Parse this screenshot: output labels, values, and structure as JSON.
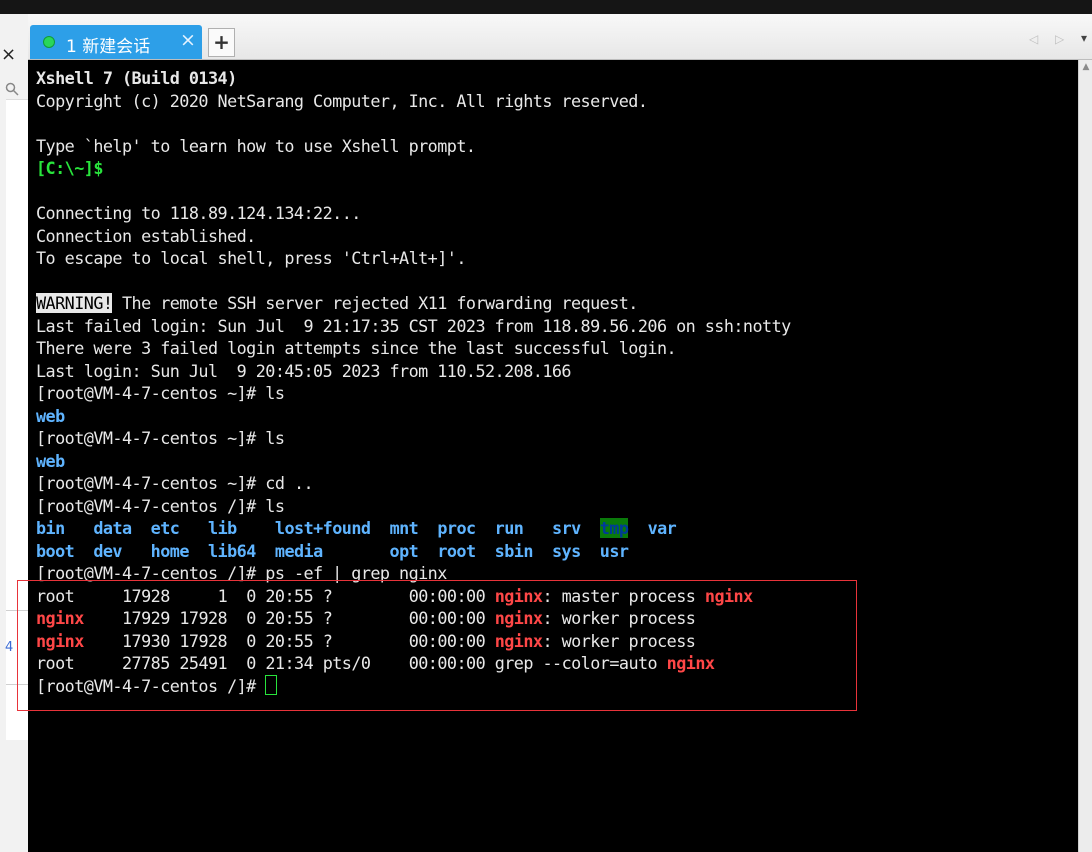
{
  "window": {
    "tab": {
      "label": "1 新建会话",
      "close": "×",
      "status_color": "#29d65c"
    },
    "add_tab": "+",
    "left_close": "×",
    "left_search_icon": "search-icon",
    "left_number": "4",
    "nav": {
      "prev": "◁",
      "next": "▷",
      "menu": "▾"
    },
    "accent": "#2d9fe8"
  },
  "terminal": {
    "header": {
      "title": "Xshell 7 (Build 0134)",
      "copyright": "Copyright (c) 2020 NetSarang Computer, Inc. All rights reserved.",
      "help": "Type `help' to learn how to use Xshell prompt.",
      "local_prompt": "[C:\\~]$"
    },
    "connect": [
      "Connecting to 118.89.124.134:22...",
      "Connection established.",
      "To escape to local shell, press 'Ctrl+Alt+]'."
    ],
    "warning": {
      "badge": "WARNING!",
      "text": " The remote SSH server rejected X11 forwarding request."
    },
    "login": [
      "Last failed login: Sun Jul  9 21:17:35 CST 2023 from 118.89.56.206 on ssh:notty",
      "There were 3 failed login attempts since the last successful login.",
      "Last login: Sun Jul  9 20:45:05 2023 from 110.52.208.166"
    ],
    "session": [
      {
        "prompt": "[root@VM-4-7-centos ~]# ",
        "cmd": "ls"
      },
      {
        "output": "web"
      },
      {
        "prompt": "[root@VM-4-7-centos ~]# ",
        "cmd": "ls"
      },
      {
        "output": "web"
      },
      {
        "prompt": "[root@VM-4-7-centos ~]# ",
        "cmd": "cd .."
      },
      {
        "prompt": "[root@VM-4-7-centos /]# ",
        "cmd": "ls"
      }
    ],
    "dirs_row1": [
      "bin",
      "data",
      "etc",
      "lib",
      "lost+found",
      "mnt",
      "proc",
      "run",
      "srv",
      "tmp",
      "var"
    ],
    "dirs_row2": [
      "boot",
      "dev",
      "home",
      "lib64",
      "media",
      "",
      "opt",
      "root",
      "sbin",
      "sys",
      "usr"
    ],
    "grep_cmd": {
      "prompt": "[root@VM-4-7-centos /]# ",
      "cmd": "ps -ef | grep nginx"
    },
    "processes": [
      {
        "user": "root",
        "pid": "17928",
        "ppid": "1",
        "c": "0",
        "stime": "20:55",
        "tty": "?",
        "time": "00:00:00",
        "cmd_hl": "nginx",
        "cmd_rest": ": master process ",
        "cmd_tail": "nginx"
      },
      {
        "user": "nginx",
        "pid": "17929",
        "ppid": "17928",
        "c": "0",
        "stime": "20:55",
        "tty": "?",
        "time": "00:00:00",
        "cmd_hl": "nginx",
        "cmd_rest": ": worker process",
        "cmd_tail": ""
      },
      {
        "user": "nginx",
        "pid": "17930",
        "ppid": "17928",
        "c": "0",
        "stime": "20:55",
        "tty": "?",
        "time": "00:00:00",
        "cmd_hl": "nginx",
        "cmd_rest": ": worker process",
        "cmd_tail": ""
      },
      {
        "user": "root",
        "pid": "27785",
        "ppid": "25491",
        "c": "0",
        "stime": "21:34",
        "tty": "pts/0",
        "time": "00:00:00",
        "cmd_hl": "",
        "cmd_rest": "grep --color=auto ",
        "cmd_tail": "nginx"
      }
    ],
    "final_prompt": "[root@VM-4-7-centos /]# ",
    "colors": {
      "green": "#28e43c",
      "red": "#ff4747",
      "blue": "#5fb4ff",
      "box": "#e8333a"
    }
  }
}
